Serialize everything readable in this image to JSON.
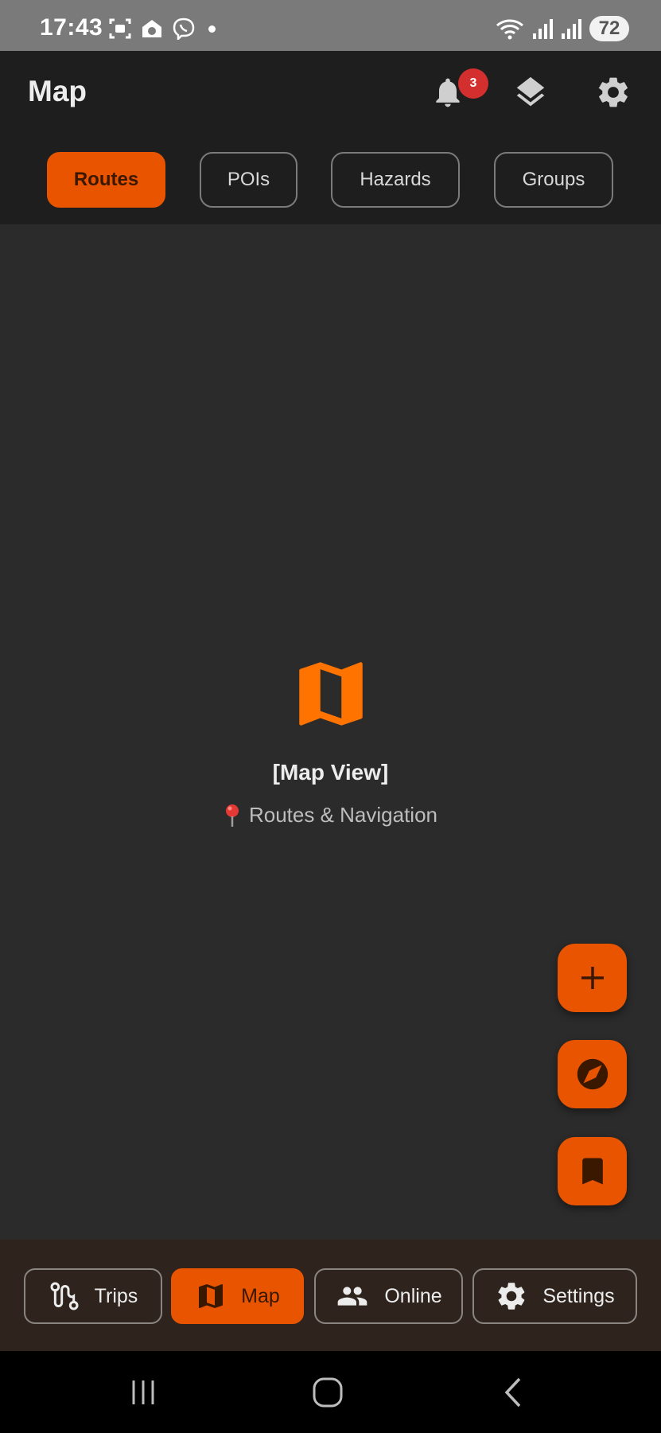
{
  "status_bar": {
    "time": "17:43",
    "battery": "72",
    "icons_left": [
      "screenshot-icon",
      "home-app-icon",
      "viber-icon",
      "notification-dot"
    ],
    "icons_right": [
      "wifi-icon",
      "signal-icon",
      "signal-icon"
    ]
  },
  "header": {
    "title": "Map",
    "notification_count": "3",
    "actions": [
      "bell-icon",
      "layers-icon",
      "gear-icon"
    ]
  },
  "filter_tabs": [
    {
      "label": "Routes",
      "active": true
    },
    {
      "label": "POIs",
      "active": false
    },
    {
      "label": "Hazards",
      "active": false
    },
    {
      "label": "Groups",
      "active": false
    }
  ],
  "map": {
    "placeholder_title": "[Map View]",
    "placeholder_subtitle": "Routes & Navigation",
    "subtitle_icon": "pin-icon"
  },
  "fabs": [
    "plus-icon",
    "compass-icon",
    "bookmark-icon"
  ],
  "bottom_nav": [
    {
      "label": "Trips",
      "icon": "route-icon",
      "active": false
    },
    {
      "label": "Map",
      "icon": "map-icon",
      "active": true
    },
    {
      "label": "Online",
      "icon": "people-icon",
      "active": false
    },
    {
      "label": "Settings",
      "icon": "gear-icon",
      "active": false
    }
  ],
  "colors": {
    "accent": "#e85400",
    "header_bg": "#1e1e1e",
    "map_bg": "#2b2b2b",
    "bottom_nav_bg": "#2e231d",
    "badge": "#d32f2f",
    "map_icon": "#ff7300"
  }
}
